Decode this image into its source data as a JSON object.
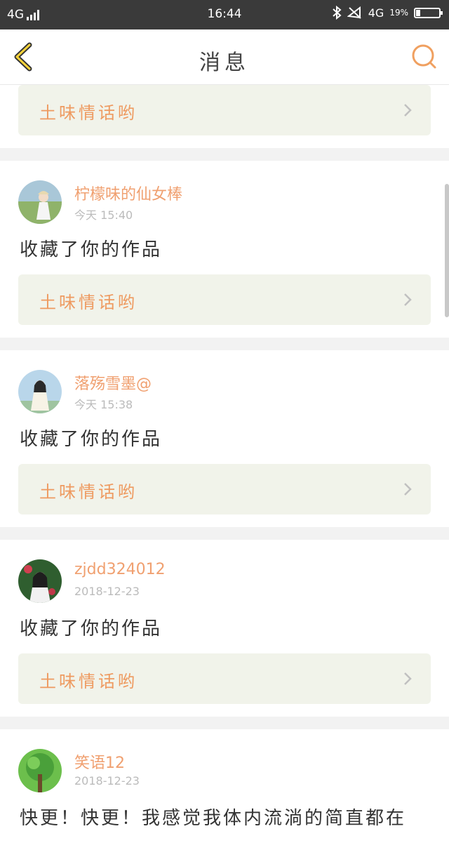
{
  "status_bar": {
    "network_left": "4G",
    "time": "16:44",
    "network_right": "4G",
    "battery_percent_label": "19%",
    "battery_level": 0.19
  },
  "nav": {
    "title": "消息",
    "back_icon": "chevron-left-icon",
    "search_icon": "search-icon",
    "accent": "#f0a060"
  },
  "cards": [
    {
      "work_title": "土味情话哟"
    },
    {
      "username": "柠檬味的仙女棒",
      "time": "今天 15:40",
      "action": "收藏了你的作品",
      "work_title": "土味情话哟",
      "avatar_color": "#8fb36a"
    },
    {
      "username": "落殇雪墨@",
      "time": "今天 15:38",
      "action": "收藏了你的作品",
      "work_title": "土味情话哟",
      "avatar_color": "#9fc4e0"
    },
    {
      "username": "zjdd324012",
      "time": "2018-12-23",
      "action": "收藏了你的作品",
      "work_title": "土味情话哟",
      "avatar_color": "#3a6a3a"
    },
    {
      "username": "笑语12",
      "time": "2018-12-23",
      "action": "快更！快更！我感觉我体内流淌的简直都在",
      "avatar_color": "#4aa03a"
    }
  ],
  "colors": {
    "username": "#f0a070",
    "work_bg": "#f1f3ea",
    "work_title": "#ee9a60",
    "status_bar_bg": "#3a3a3a"
  }
}
